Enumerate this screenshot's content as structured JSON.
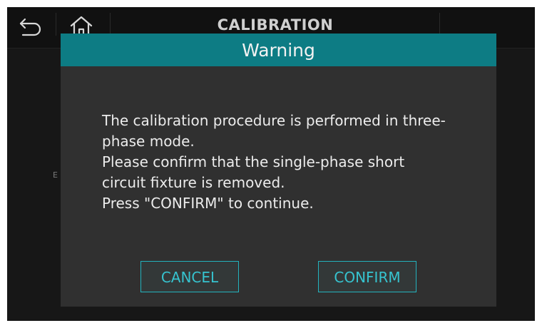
{
  "topbar": {
    "title": "CALIBRATION",
    "back_icon": "back-arrow-icon",
    "home_icon": "home-icon"
  },
  "background": {
    "label": "E"
  },
  "dialog": {
    "title": "Warning",
    "message_lines": [
      "The calibration procedure is performed in three-",
      "phase mode.",
      "Please confirm that the single-phase short",
      "circuit fixture is removed.",
      "Press \"CONFIRM\" to continue."
    ],
    "cancel_label": "CANCEL",
    "confirm_label": "CONFIRM"
  },
  "colors": {
    "header": "#0d7c84",
    "dialog_bg": "#303030",
    "button_border": "#23b3be",
    "button_text": "#36c3cf",
    "screen_bg": "#171717"
  }
}
